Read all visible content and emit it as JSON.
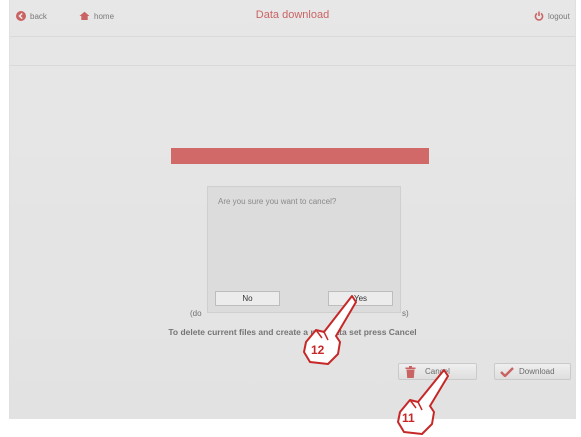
{
  "nav": {
    "back_label": "back",
    "home_label": "home",
    "logout_label": "logout"
  },
  "header": {
    "title": "Data download"
  },
  "content": {
    "partial_left": "(do",
    "partial_right": "s)",
    "instruction": "To delete current files and create a new data set press Cancel"
  },
  "buttons": {
    "cancel_label": "Cancel",
    "download_label": "Download"
  },
  "dialog": {
    "message": "Are you sure you want to cancel?",
    "no_label": "No",
    "yes_label": "Yes"
  },
  "callouts": {
    "step_12": "12",
    "step_11": "11"
  },
  "colors": {
    "accent": "#c62828",
    "bar": "#d03230"
  }
}
